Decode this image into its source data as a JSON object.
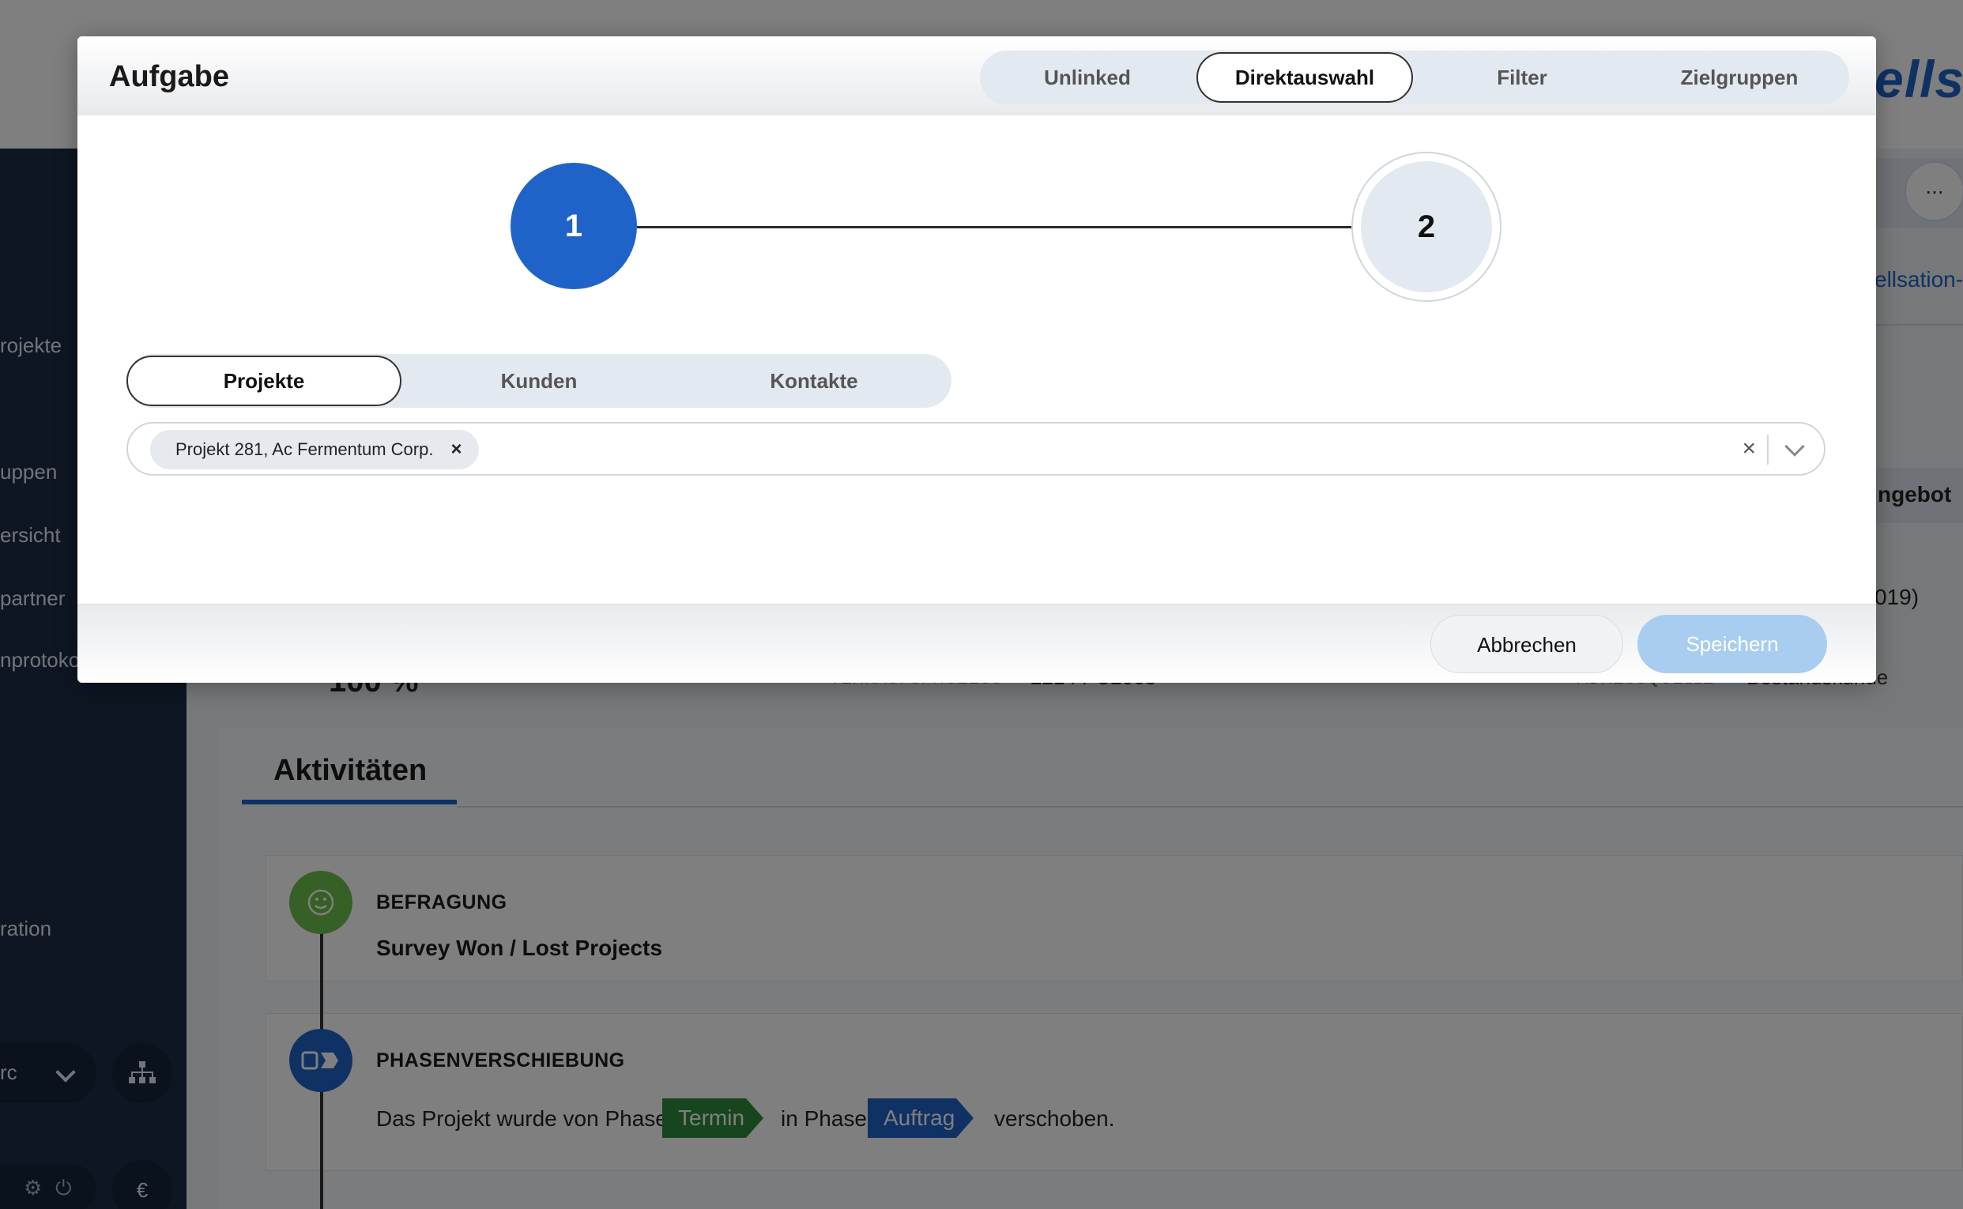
{
  "background": {
    "brand_partial": "ells",
    "sidebar_items": [
      "rojekte",
      "uppen",
      "ersicht",
      "partner",
      "nprotoko",
      "ration"
    ],
    "sidebar_dropdown_value": "rc",
    "bottom_icons": [
      "gear-icon",
      "power-icon"
    ],
    "currency_symbol": "€",
    "more_label": "...",
    "partial_link": "ellsation-c",
    "partial_tab": "ngebot",
    "partial_year": "019)",
    "row_percent": "100 %",
    "row_label_1": "VERKAUFSPROZESS",
    "row_value_1": "2214 PC2063",
    "row_label_2": "ADRESSQUELLE",
    "row_value_2": "Bestandskunde",
    "activities": {
      "title": "Aktivitäten",
      "items": [
        {
          "heading": "BEFRAGUNG",
          "subtitle": "Survey Won / Lost Projects"
        },
        {
          "heading": "PHASENVERSCHIEBUNG",
          "text_before": "Das Projekt wurde von Phase",
          "from_phase": "Termin",
          "text_middle": "in Phase",
          "to_phase": "Auftrag",
          "text_after": "verschoben."
        }
      ]
    }
  },
  "modal": {
    "title": "Aufgabe",
    "header_tabs": [
      {
        "label": "Unlinked",
        "active": false
      },
      {
        "label": "Direktauswahl",
        "active": true
      },
      {
        "label": "Filter",
        "active": false
      },
      {
        "label": "Zielgruppen",
        "active": false
      }
    ],
    "steps": [
      "1",
      "2"
    ],
    "current_step": 1,
    "entity_tabs": [
      {
        "label": "Projekte",
        "active": true
      },
      {
        "label": "Kunden",
        "active": false
      },
      {
        "label": "Kontakte",
        "active": false
      }
    ],
    "selected_items": [
      "Projekt 281, Ac Fermentum Corp."
    ],
    "chip_remove_symbol": "×",
    "clear_symbol": "×",
    "footer": {
      "cancel_label": "Abbrechen",
      "save_label": "Speichern"
    }
  },
  "colors": {
    "accent": "#1f63c8",
    "save_disabled": "#a8cdf0",
    "sidebar": "#1a2d45",
    "survey_green": "#6cc04a",
    "tag_termin": "#2e8b3a",
    "tag_auftrag": "#1f63c8"
  }
}
